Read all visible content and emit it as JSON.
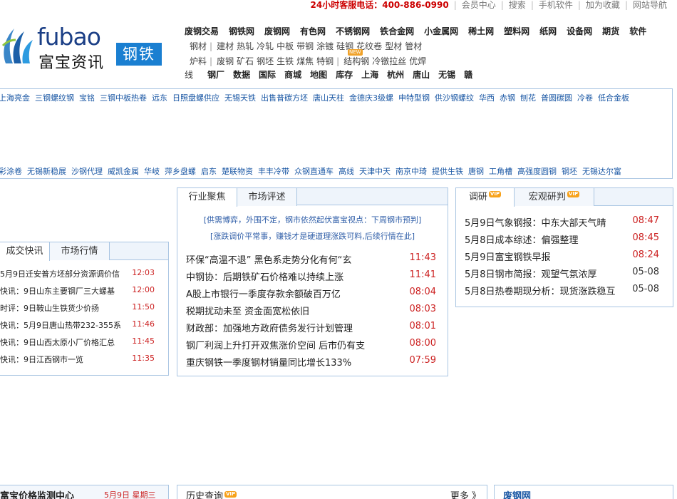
{
  "topbar": {
    "hotline": "24小时客服电话：400-886-0990",
    "links": [
      "会员中心",
      "搜索",
      "手机软件",
      "加为收藏",
      "网站导航"
    ]
  },
  "logo": {
    "en": "fubao",
    "cn": "富宝资讯",
    "badge": "钢铁"
  },
  "nav": {
    "main": [
      "废钢交易",
      "钢铁网",
      "废钢网",
      "有色网",
      "不锈钢网",
      "铁合金网",
      "小金属网",
      "稀土网",
      "塑料网",
      "纸网",
      "设备网",
      "期货",
      "软件"
    ],
    "row2": [
      "钢材",
      "|",
      "建材",
      "热轧",
      "冷轧",
      "中板",
      "带钢",
      "涂镀",
      "硅钢",
      "花纹卷",
      "型材",
      "管材"
    ],
    "row3": [
      "炉料",
      "|",
      "废钢",
      "矿石",
      "钢坯",
      "生铁",
      "煤焦",
      "特钢",
      "|",
      "结构钢",
      "冷镦拉丝",
      "优焊"
    ],
    "new_tag": "NEW",
    "row4_first": "线",
    "row4": [
      "钢厂",
      "数据",
      "国际",
      "商城",
      "地图",
      "库存",
      "上海",
      "杭州",
      "唐山",
      "无锡",
      "赣"
    ]
  },
  "link_panel": {
    "line1": [
      "上海亮金",
      "三钢螺纹钢",
      "宝铭",
      "三钢中板热卷",
      "远东",
      "日照盘螺供应",
      "无锡天铁",
      "出售普碳方坯",
      "唐山天柱",
      "金德庆3级螺",
      "申特型钢",
      "供沙钢螺纹",
      "华西",
      "赤钢",
      "刨花",
      "普圆碳圆",
      "冷卷",
      "低合金板"
    ],
    "line2": [
      "彩涂卷",
      "无锡新稳展",
      "沙钢代理",
      "威凯金属",
      "华岐",
      "萍乡盘螺",
      "启东",
      "楚联物资",
      "丰丰冷带",
      "众钢直通车",
      "高线",
      "天津中天",
      "南京中琦",
      "提供生铁",
      "唐钢",
      "工角槽",
      "高强度圆钢",
      "钢坯",
      "无锡达尔富"
    ]
  },
  "left_panel": {
    "tabs": [
      "成交快讯",
      "市场行情"
    ],
    "items": [
      {
        "title": "5月9日迁安普方坯部分资源调价信",
        "time": "12:03"
      },
      {
        "title": "快讯：9日山东主要钢厂三大螺基",
        "time": "12:00"
      },
      {
        "title": "时评：9日鞍山生铁货少价扬",
        "time": "11:50"
      },
      {
        "title": "快讯：5月9日唐山热带232-355系",
        "time": "11:46"
      },
      {
        "title": "快讯：9日山西太原小厂价格汇总",
        "time": "11:45"
      },
      {
        "title": "快讯：9日江西钢市一览",
        "time": "11:35"
      }
    ]
  },
  "mid_panel": {
    "tabs": [
      "行业聚焦",
      "市场评述"
    ],
    "notes": [
      "[供需博弈，外围不定，钢市依然起伏富宝视点：下周钢市预判]",
      "[涨跌调价平常事，赚钱才是硬道理涨跌可料,后续行情在此]"
    ],
    "items": [
      {
        "title": "环保“高温不退” 黑色系走势分化有何“玄",
        "time": "11:43"
      },
      {
        "title": "中钢协：后期铁矿石价格难以持续上涨",
        "time": "11:41"
      },
      {
        "title": "A股上市银行一季度存款余额破百万亿",
        "time": "08:04"
      },
      {
        "title": "税期扰动未至 资金面宽松依旧",
        "time": "08:03"
      },
      {
        "title": "财政部：加强地方政府债务发行计划管理",
        "time": "08:01"
      },
      {
        "title": "钢厂利润上升打开双焦涨价空间 后市仍有支",
        "time": "08:00"
      },
      {
        "title": "重庆钢铁一季度钢材销量同比增长133%",
        "time": "07:59"
      }
    ]
  },
  "right_panel": {
    "tabs": [
      "调研",
      "宏观研判"
    ],
    "vip": "VIP",
    "items": [
      {
        "title": "5月9日气象钢报：中东大部天气晴",
        "time": "08:47",
        "red": true
      },
      {
        "title": "5月8日成本综述：偏强整理",
        "time": "08:45",
        "red": true
      },
      {
        "title": "5月9日富宝钢铁早报",
        "time": "08:24",
        "red": true
      },
      {
        "title": "5月8日钢市简报：观望气氛浓厚",
        "time": "05-08",
        "red": false
      },
      {
        "title": "5月8日热卷期现分析：现货涨跌稳互",
        "time": "05-08",
        "red": false
      }
    ]
  },
  "bottom": {
    "left_title": "富宝价格监测中心",
    "left_date": "5月9日 星期三",
    "mid_title": "历史查询",
    "mid_more": "更多 》",
    "right_title": "废钢网"
  }
}
